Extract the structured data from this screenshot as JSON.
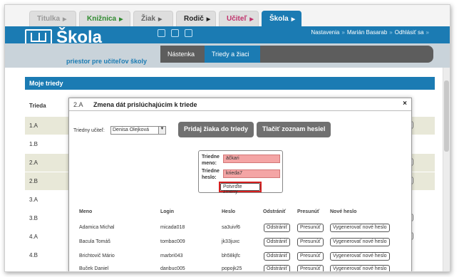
{
  "tabs": [
    {
      "label": "Titulka",
      "color": "#999999"
    },
    {
      "label": "Knižnica",
      "color": "#2f8a2f"
    },
    {
      "label": "Žiak",
      "color": "#666666"
    },
    {
      "label": "Rodič",
      "color": "#222222"
    },
    {
      "label": "Učiteľ",
      "color": "#c0306a"
    },
    {
      "label": "Škola",
      "color": "#ffffff"
    }
  ],
  "header": {
    "logo": "Škola",
    "tagline": "priestor pre učiteľov školy",
    "nav": {
      "settings": "Nastavenia",
      "user": "Marián Basarab",
      "logout": "Odhlásiť sa"
    },
    "social_icons": [
      "facebook-icon",
      "twitter-icon",
      "mail-icon"
    ]
  },
  "subtabs": [
    "Nástenka",
    "Triedy a žiaci"
  ],
  "main": {
    "section_title": "Moje triedy",
    "column": "Trieda",
    "classes": [
      "1.A",
      "1.B",
      "2.A",
      "2.B",
      "3.A",
      "3.B",
      "4.A",
      "4.B"
    ],
    "edge_button": "m"
  },
  "modal": {
    "code": "2.A",
    "title": "Zmena dát prislúchajúcim k triede",
    "close": "×",
    "teacher_label": "Triedny učiteľ:",
    "teacher_value": "Denisa Olejková",
    "add_student": "Pridaj žiaka do triedy",
    "print_passwords": "Tlačiť zoznam hesiel",
    "class_name_label": "Triedne meno:",
    "class_name_value": "äčkari",
    "class_pass_label": "Triedne heslo:",
    "class_pass_value": "krieda7",
    "confirm": "Potvrďte zmeny",
    "columns": [
      "Meno",
      "Login",
      "Heslo",
      "Odstrániť",
      "Presunúť",
      "Nové heslo"
    ],
    "students": [
      {
        "name": "Adamica Michal",
        "login": "micada018",
        "password": "sa3uivf6"
      },
      {
        "name": "Bacula Tomáš",
        "login": "tombac009",
        "password": "jk33juxc"
      },
      {
        "name": "Brichtovič Mário",
        "login": "marbri043",
        "password": "bh58kjfc"
      },
      {
        "name": "Buček Daniel",
        "login": "danbuc005",
        "password": "popojk25"
      }
    ],
    "btn_remove": "Odstrániť",
    "btn_move": "Presunúť",
    "btn_newpass": "Vygenerovať nové heslo"
  }
}
